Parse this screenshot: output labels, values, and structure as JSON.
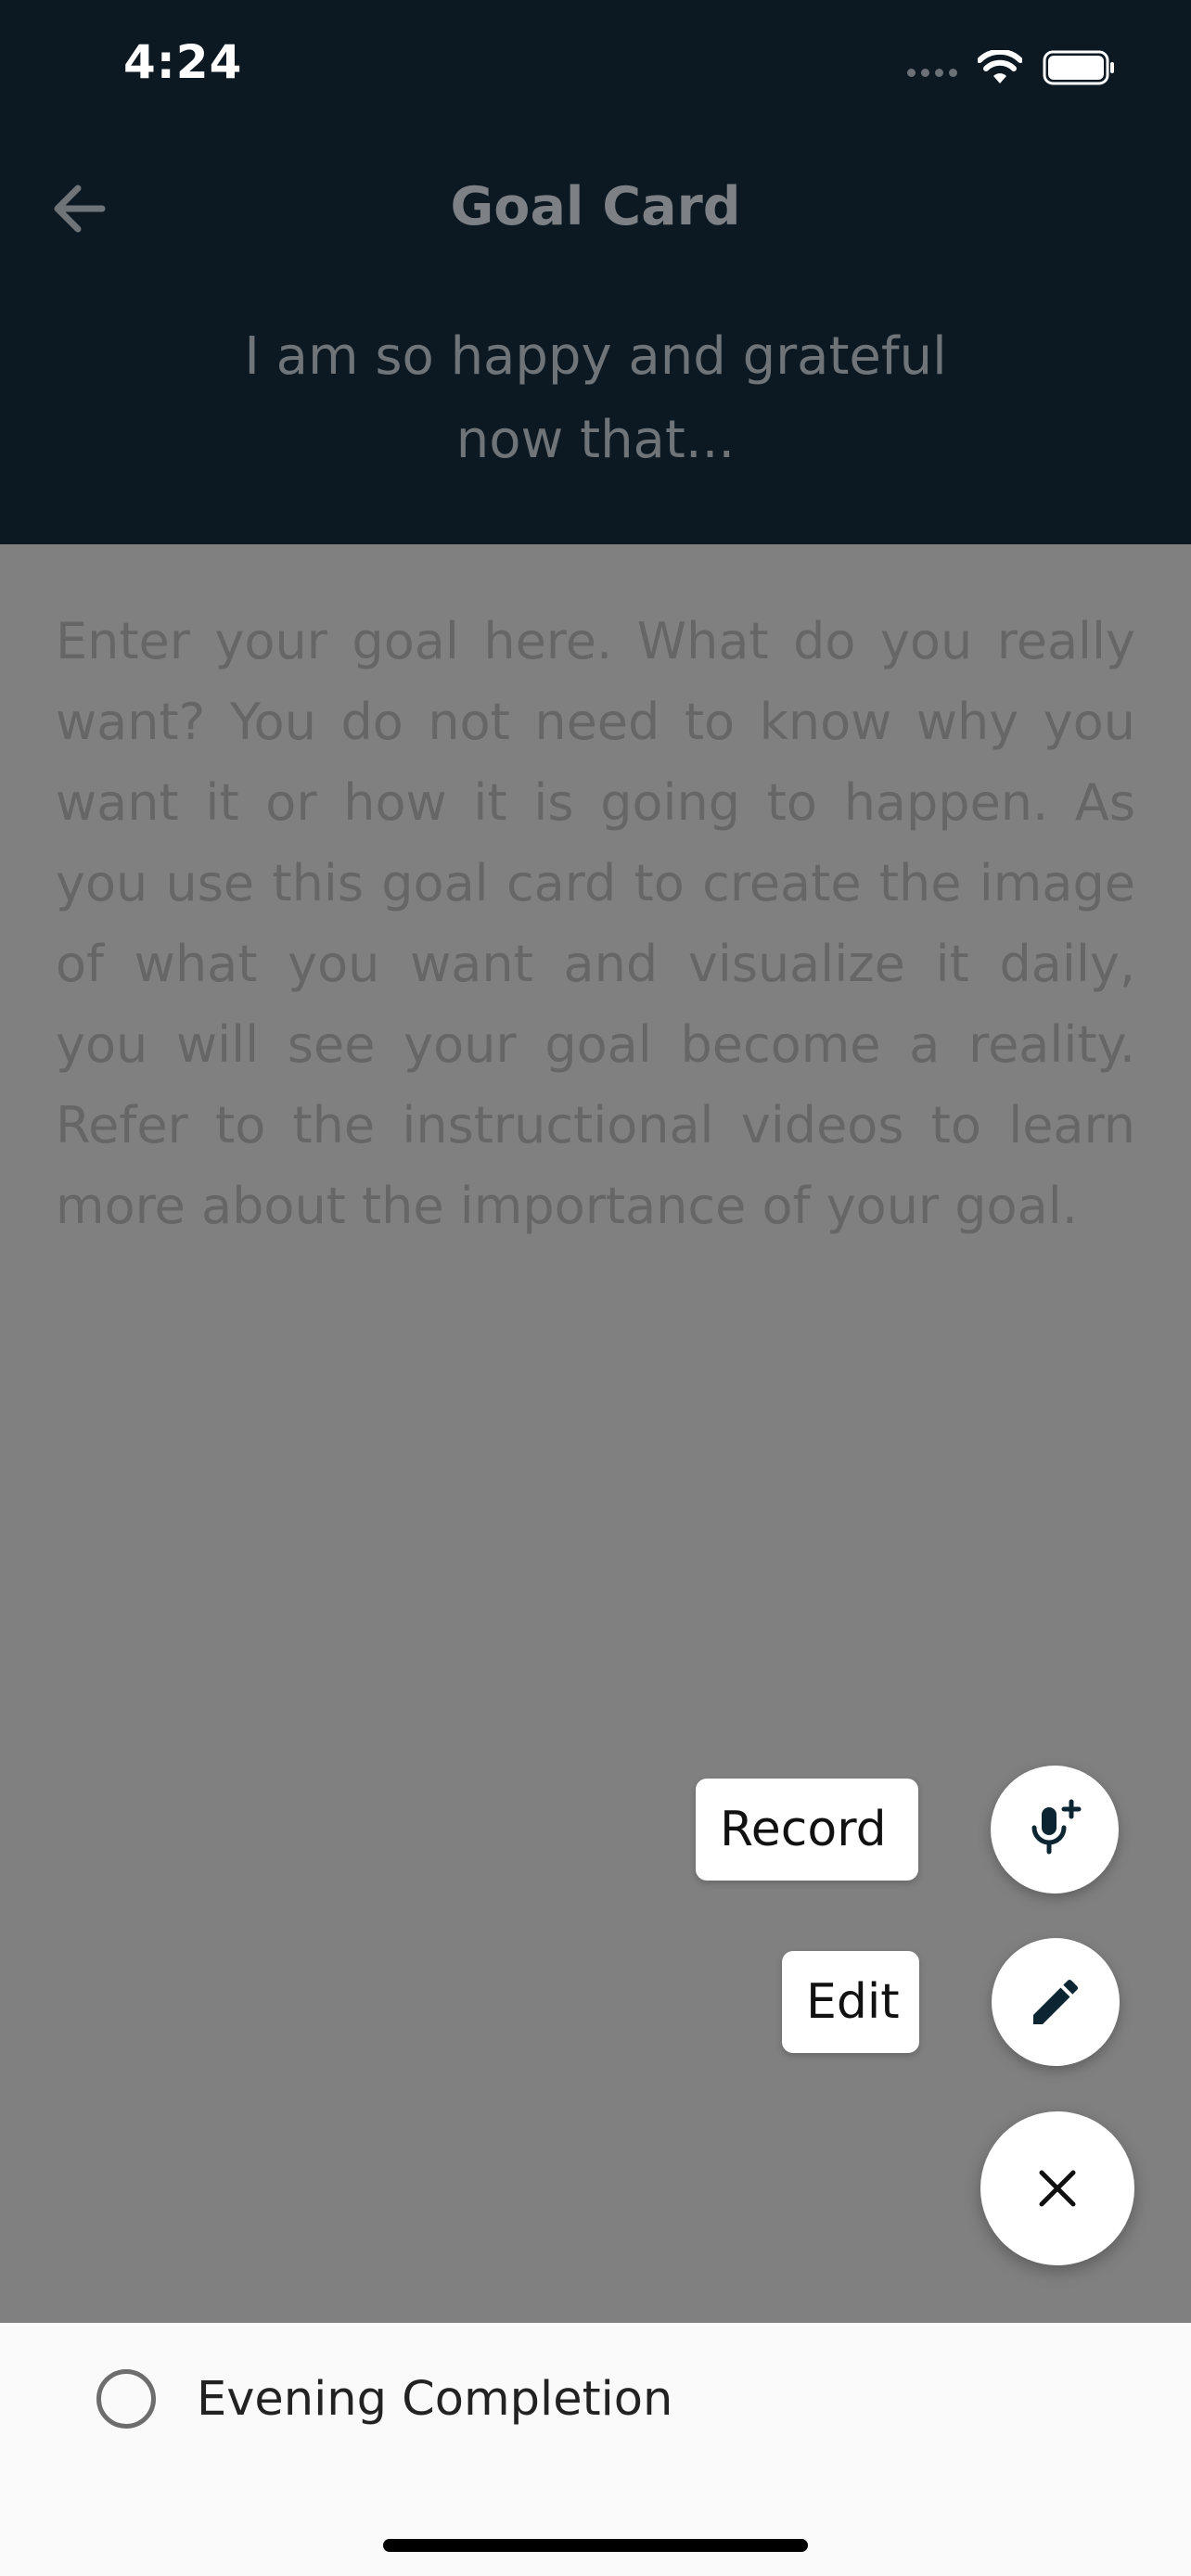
{
  "status_bar": {
    "time": "4:24",
    "icons": [
      "cellular-signal-icon",
      "wifi-icon",
      "battery-icon"
    ]
  },
  "header": {
    "back_icon": "arrow-left-icon",
    "title": "Goal Card",
    "subtitle": "I am so happy and grateful now that..."
  },
  "goal": {
    "placeholder": "Enter your goal here. What do you really want? You do not need to know why you want it or how it is going to happen. As you use this goal card to create the image of what you want and visualize it daily, you will see your goal become a reality. Refer to the instructional videos to learn more about the importance of your goal."
  },
  "fab_menu": {
    "record_label": "Record",
    "record_icon": "microphone-plus-icon",
    "edit_label": "Edit",
    "edit_icon": "pencil-icon",
    "close_icon": "close-icon"
  },
  "footer": {
    "completion_label": "Evening Completion",
    "completion_checked": false
  },
  "colors": {
    "header_bg": "#0c1923",
    "overlay": "#808080",
    "fab_icon": "#0c2533",
    "footer_bg": "#fafafa"
  }
}
